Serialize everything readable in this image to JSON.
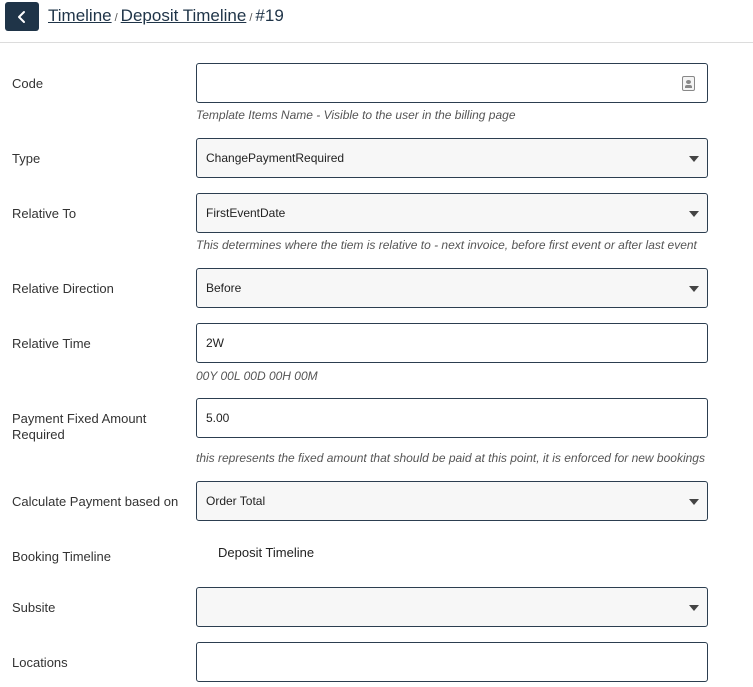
{
  "breadcrumb": {
    "items": [
      "Timeline",
      "Deposit Timeline"
    ],
    "separator": "/",
    "current": "#19"
  },
  "form": {
    "code": {
      "label": "Code",
      "value": "",
      "help": "Template Items Name - Visible to the user in the billing page",
      "icon": "contact-card-icon"
    },
    "type": {
      "label": "Type",
      "value": "ChangePaymentRequired"
    },
    "relative_to": {
      "label": "Relative To",
      "value": "FirstEventDate",
      "help": "This determines where the tiem is relative to - next invoice, before first event or after last event"
    },
    "relative_direction": {
      "label": "Relative Direction",
      "value": "Before"
    },
    "relative_time": {
      "label": "Relative Time",
      "value": "2W",
      "help": "00Y 00L 00D 00H 00M"
    },
    "payment_fixed_amount": {
      "label_line1": "Payment Fixed Amount",
      "label_line2": "Required",
      "value": "5.00",
      "help": "this represents the fixed amount that should be paid at this point, it is enforced for new bookings"
    },
    "calculate_payment": {
      "label": "Calculate Payment based on",
      "value": "Order Total"
    },
    "booking_timeline": {
      "label": "Booking Timeline",
      "value": "Deposit Timeline"
    },
    "subsite": {
      "label": "Subsite",
      "value": ""
    },
    "locations": {
      "label": "Locations",
      "value": ""
    }
  },
  "colors": {
    "accent": "#1f3448",
    "border": "#2c3e50"
  }
}
